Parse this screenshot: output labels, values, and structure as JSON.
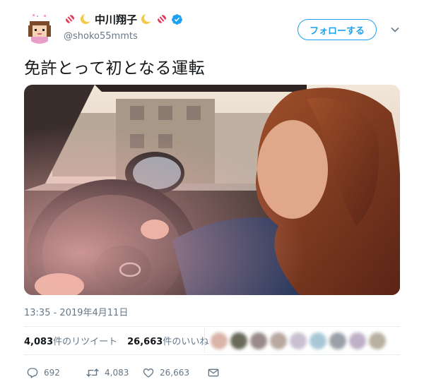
{
  "user": {
    "display_name": "中川翔子",
    "handle": "@shoko55mmts",
    "verified": true,
    "name_decorations": [
      "candy-icon",
      "crescent-moon-icon",
      "crescent-moon-icon",
      "candy-icon"
    ]
  },
  "follow_button": {
    "label": "フォローする"
  },
  "tweet": {
    "text": "免許とって初となる運転",
    "timestamp": "13:35 - 2019年4月11日"
  },
  "stats": {
    "retweets_count": "4,083",
    "retweets_label": "件のリツイート",
    "likes_count": "26,663",
    "likes_label": "件のいいね"
  },
  "actions": {
    "reply_count": "692",
    "retweet_count": "4,083",
    "like_count": "26,663"
  },
  "colors": {
    "accent": "#1da1f2",
    "verified": "#1da1f2",
    "text_secondary": "#657786",
    "divider": "#e6ecf0"
  },
  "media": {
    "type": "video-still",
    "icon": "car-interior-photo"
  }
}
